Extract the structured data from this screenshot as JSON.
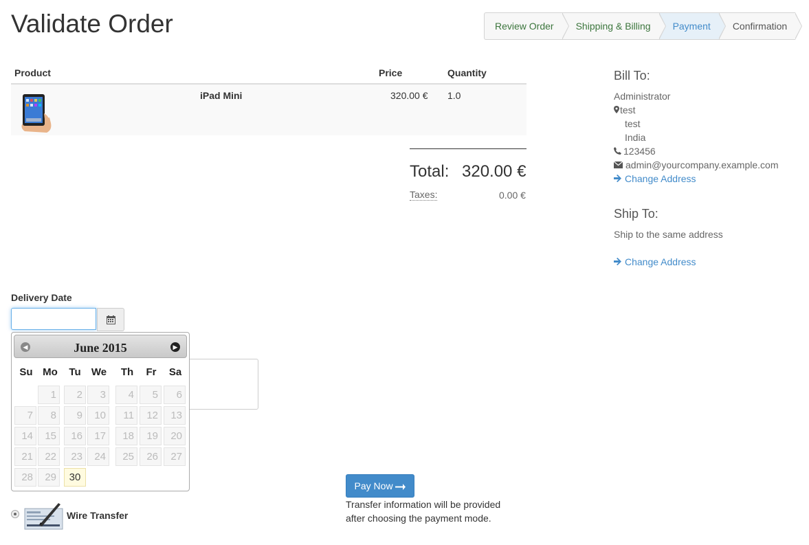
{
  "page": {
    "title": "Validate Order"
  },
  "wizard": {
    "steps": [
      {
        "label": "Review Order",
        "state": "done"
      },
      {
        "label": "Shipping & Billing",
        "state": "done"
      },
      {
        "label": "Payment",
        "state": "active"
      },
      {
        "label": "Confirmation",
        "state": "pending"
      }
    ]
  },
  "cart": {
    "headers": {
      "product": "Product",
      "price": "Price",
      "quantity": "Quantity"
    },
    "lines": [
      {
        "name": "iPad Mini",
        "price": "320.00 €",
        "quantity": "1.0",
        "image_icon": "ipad-mini-image"
      }
    ],
    "total_label": "Total:",
    "total_value": "320.00 €",
    "taxes_label": "Taxes:",
    "taxes_value": "0.00 €"
  },
  "bill_to": {
    "heading": "Bill To:",
    "name": "Administrator",
    "address_line1": "test",
    "address_line2": "test",
    "country": "India",
    "phone": "123456",
    "email": "admin@yourcompany.example.com",
    "change_label": "Change Address"
  },
  "ship_to": {
    "heading": "Ship To:",
    "text": "Ship to the same address",
    "change_label": "Change Address"
  },
  "delivery": {
    "label": "Delivery Date",
    "value": "",
    "calendar": {
      "month_label": "June 2015",
      "weekdays": [
        "Su",
        "Mo",
        "Tu",
        "We",
        "Th",
        "Fr",
        "Sa"
      ],
      "weeks": [
        [
          "",
          "1",
          "2",
          "3",
          "4",
          "5",
          "6"
        ],
        [
          "7",
          "8",
          "9",
          "10",
          "11",
          "12",
          "13"
        ],
        [
          "14",
          "15",
          "16",
          "17",
          "18",
          "19",
          "20"
        ],
        [
          "21",
          "22",
          "23",
          "24",
          "25",
          "26",
          "27"
        ],
        [
          "28",
          "29",
          "30",
          "",
          "",
          "",
          ""
        ]
      ],
      "today": "30",
      "prev_icon": "circle-triangle-left-icon",
      "next_icon": "circle-triangle-right-icon"
    }
  },
  "payment": {
    "method_label": "Wire Transfer",
    "pay_button": "Pay Now",
    "info_line1": "Transfer information will be provided",
    "info_line2": "after choosing the payment mode."
  },
  "colors": {
    "link": "#428bca",
    "active_step": "#428bca",
    "done_step": "#3c763d"
  }
}
